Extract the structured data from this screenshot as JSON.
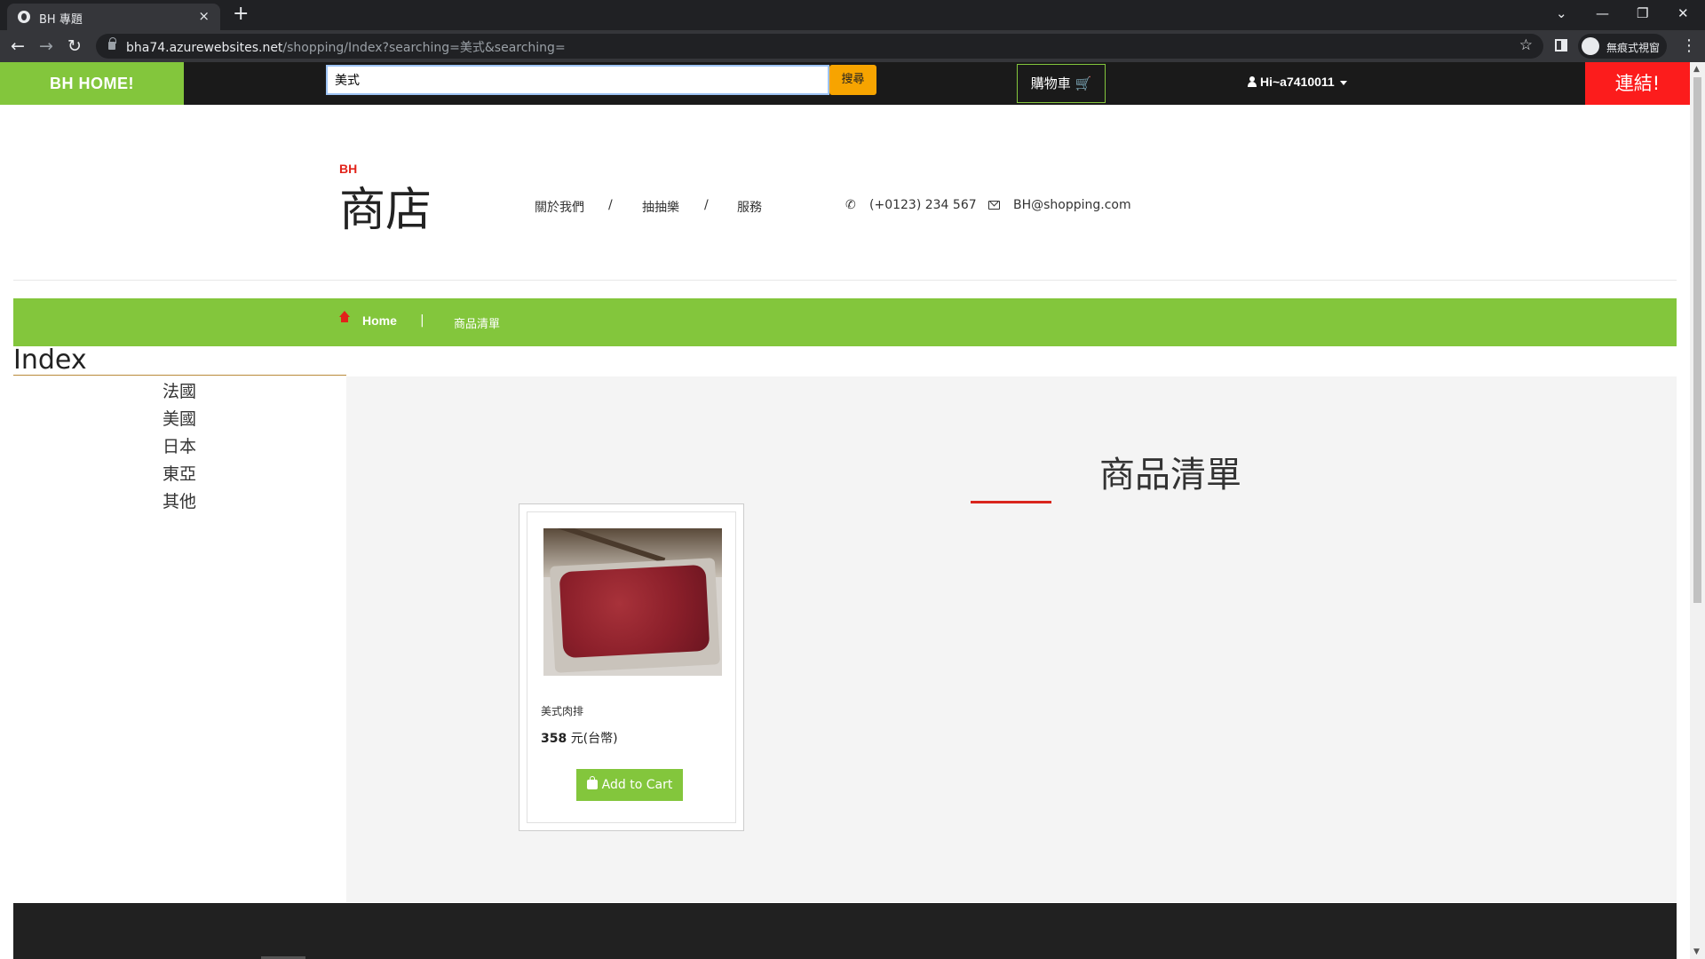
{
  "browser": {
    "tab_title": "BH 專題",
    "tab_close": "×",
    "new_tab": "+",
    "url_host": "bha74.azurewebsites.net",
    "url_path": "/shopping/Index?searching=美式&searching=",
    "incognito_label": "無痕式視窗"
  },
  "topnav": {
    "home_label": "BH HOME!",
    "search_value": "美式",
    "search_button": "搜尋",
    "cart_label": "購物車 🛒",
    "user_label": "Hi~a7410011",
    "link_label": "連結!"
  },
  "header": {
    "logo_small": "BH",
    "logo_big": "商店",
    "nav": [
      "關於我們",
      "/",
      "抽抽樂",
      "/",
      "服務"
    ],
    "phone": "(+0123) 234 567",
    "email": "BH@shopping.com"
  },
  "breadcrumb": {
    "home": "Home",
    "separator": "|",
    "current": "商品清單"
  },
  "sidebar": {
    "title": "Index",
    "categories": [
      "法國",
      "美國",
      "日本",
      "東亞",
      "其他"
    ]
  },
  "main": {
    "title": "商品清單",
    "products": [
      {
        "name": "美式肉排",
        "price_number": "358",
        "price_unit": "元(台幣)",
        "button": "Add to Cart"
      }
    ]
  },
  "colors": {
    "accent_green": "#83c63c",
    "search_orange": "#f7a400",
    "link_red": "#fc1c1c",
    "underline_red": "#d9251d"
  }
}
